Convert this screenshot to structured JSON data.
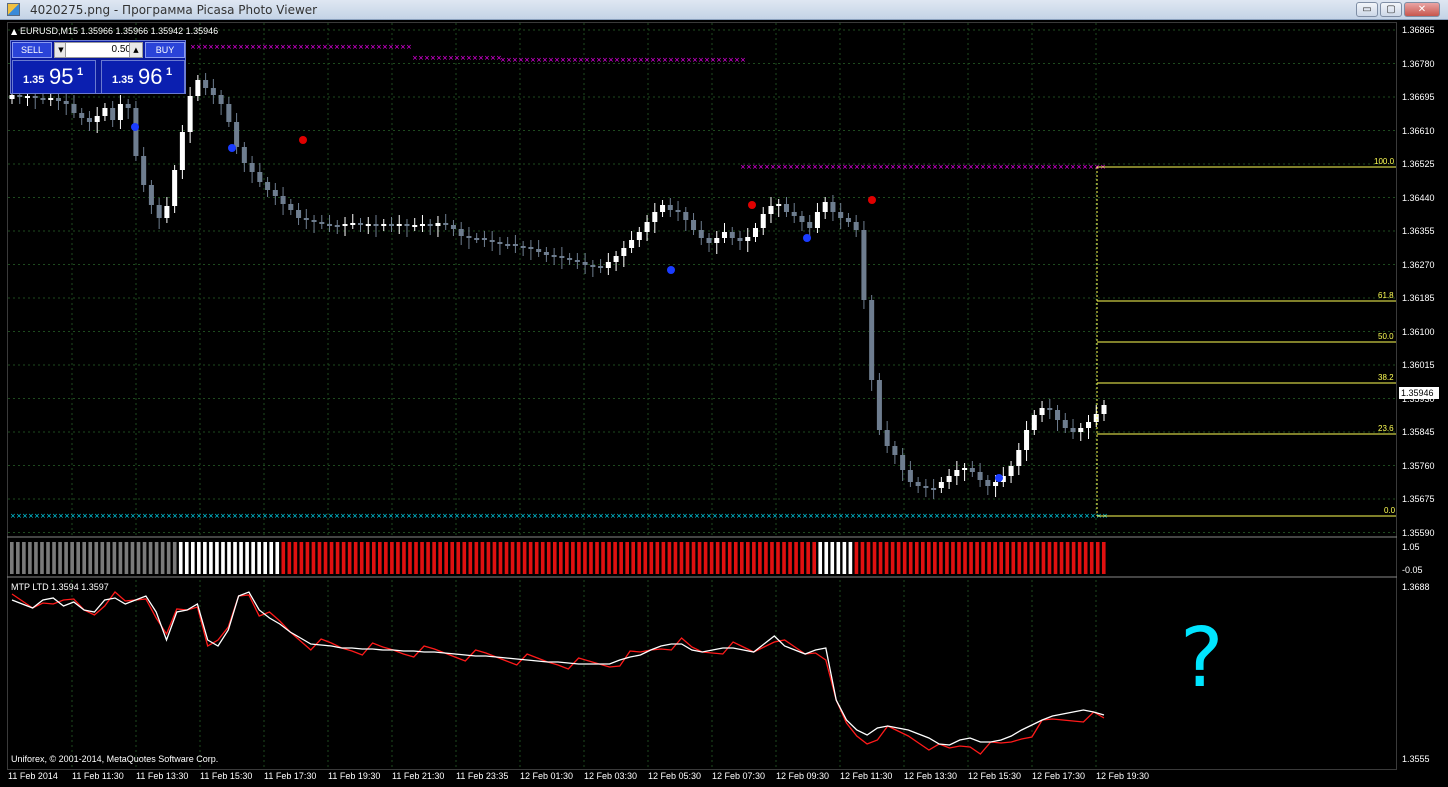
{
  "window": {
    "title": "4020275.png - Программа Picasa Photo Viewer",
    "buttons": [
      "▭",
      "▢",
      "✕"
    ]
  },
  "chart": {
    "symbol_info": "EURUSD,M15  1.35966 1.35966 1.35942 1.35946",
    "current_price": "1.35946",
    "price_ticks": [
      "1.36865",
      "1.36780",
      "1.36695",
      "1.36610",
      "1.36525",
      "1.36440",
      "1.36355",
      "1.36270",
      "1.36185",
      "1.36100",
      "1.36015",
      "1.35930",
      "1.35845",
      "1.35760",
      "1.35675",
      "1.35590"
    ],
    "time_ticks": [
      "11 Feb 2014",
      "11 Feb 11:30",
      "11 Feb 13:30",
      "11 Feb 15:30",
      "11 Feb 17:30",
      "11 Feb 19:30",
      "11 Feb 21:30",
      "11 Feb 23:35",
      "12 Feb 01:30",
      "12 Feb 03:30",
      "12 Feb 05:30",
      "12 Feb 07:30",
      "12 Feb 09:30",
      "12 Feb 11:30",
      "12 Feb 13:30",
      "12 Feb 15:30",
      "12 Feb 17:30",
      "12 Feb 19:30"
    ],
    "fib_levels": [
      "100.0",
      "61.8",
      "50.0",
      "38.2",
      "23.6",
      "0.0"
    ],
    "annotation": "?"
  },
  "trade_panel": {
    "sell_label": "SELL",
    "buy_label": "BUY",
    "lot_value": "0.50",
    "bid_prefix": "1.35",
    "bid_big": "95",
    "bid_sup": "1",
    "ask_prefix": "1.35",
    "ask_big": "96",
    "ask_sup": "1"
  },
  "histogram_panel": {
    "scale_top": "1.05",
    "scale_bottom": "-0.05"
  },
  "indicator_panel": {
    "label": "MTP LTD 1.3594 1.3597",
    "scale_top": "1.3688",
    "scale_bottom": "1.3555"
  },
  "footer": {
    "copyright": "Uniforex, © 2001-2014, MetaQuotes Software Corp."
  },
  "colors": {
    "bull_candle": "#ffffff",
    "bear_candle": "#6e7d8f",
    "resistance": "#ff00ff",
    "support": "#00e5ff",
    "fib": "#ffff55",
    "grid": "#1e4a1e",
    "hist_red": "#e01010",
    "line_white": "#ffffff",
    "line_red": "#ff1a1a",
    "signal_up": "#1a3cff",
    "signal_down": "#e00000"
  }
}
